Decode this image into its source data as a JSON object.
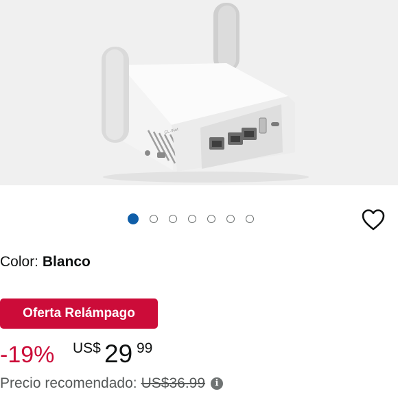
{
  "product": {
    "image_alt": "GL.iNet travel router",
    "brand_print": "GL-iNet",
    "carousel": {
      "count": 7,
      "active_index": 0
    }
  },
  "actions": {
    "wishlist_icon": "heart-outline-icon"
  },
  "variation": {
    "label": "Color:",
    "value": "Blanco"
  },
  "deal": {
    "badge": "Oferta Relámpago",
    "badge_color": "#cc0c39"
  },
  "price": {
    "discount": "-19%",
    "currency": "US$",
    "whole": "29",
    "fraction": "99",
    "discount_color": "#cc0c39"
  },
  "list_price": {
    "label": "Precio recomendado:",
    "value": "US$36.99",
    "info_icon": "info-icon"
  }
}
